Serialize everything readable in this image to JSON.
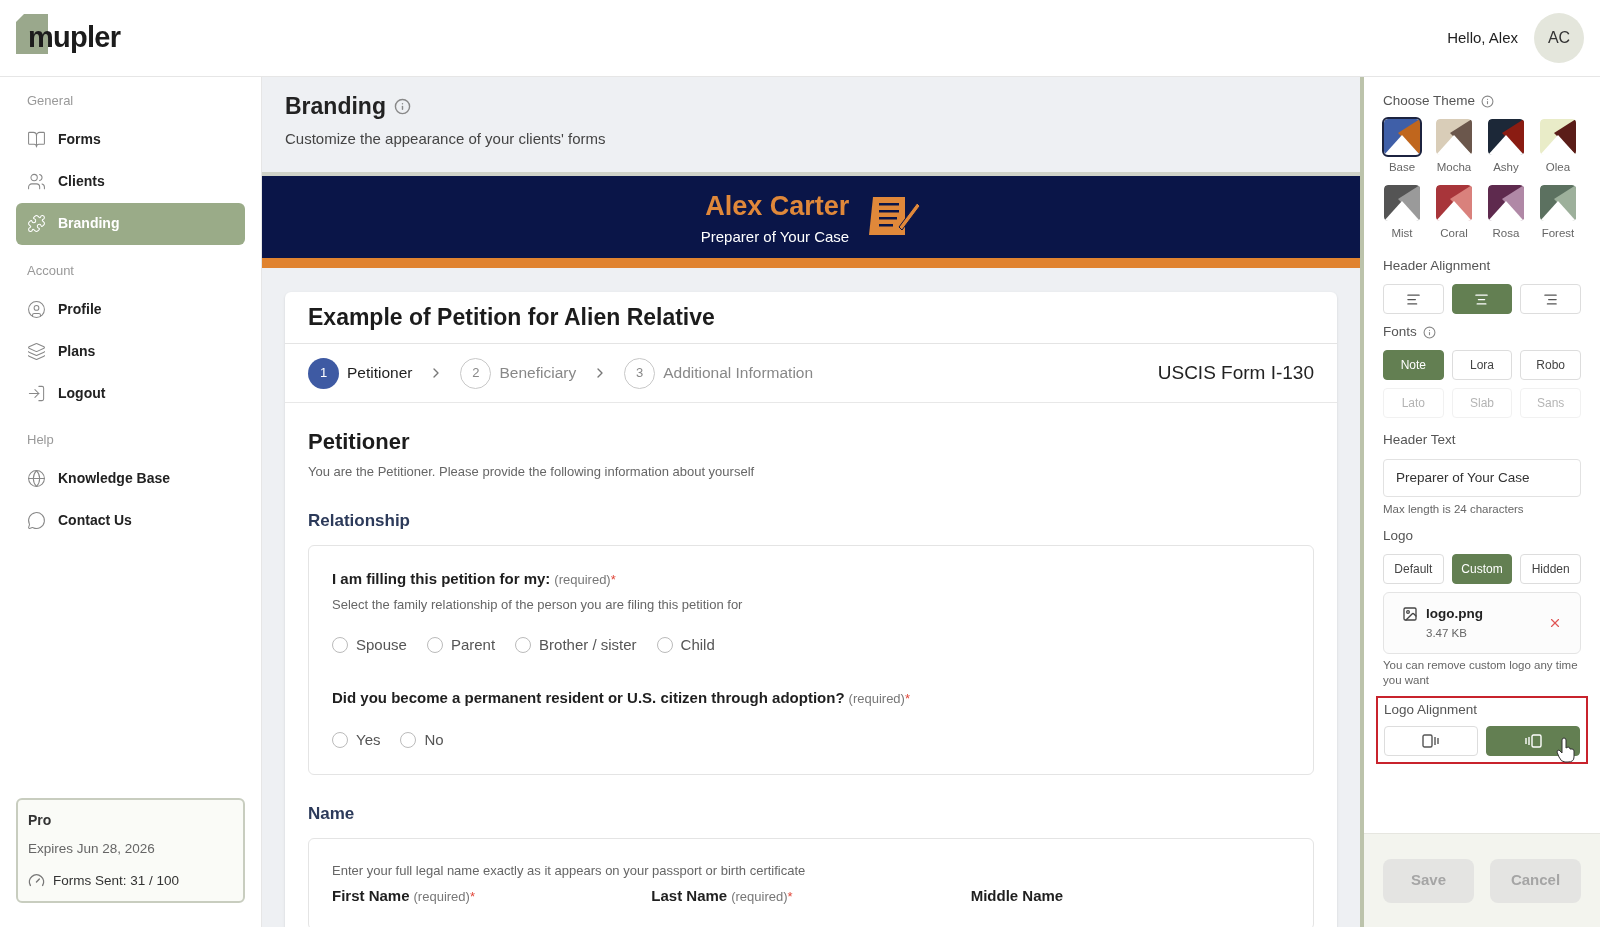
{
  "brand": {
    "name": "mupler"
  },
  "user": {
    "greeting": "Hello, Alex",
    "initials": "AC"
  },
  "sidebar": {
    "sections": [
      {
        "title": "General",
        "items": [
          {
            "label": "Forms",
            "selected": false
          },
          {
            "label": "Clients",
            "selected": false
          },
          {
            "label": "Branding",
            "selected": true
          }
        ]
      },
      {
        "title": "Account",
        "items": [
          {
            "label": "Profile",
            "selected": false
          },
          {
            "label": "Plans",
            "selected": false
          },
          {
            "label": "Logout",
            "selected": false
          }
        ]
      },
      {
        "title": "Help",
        "items": [
          {
            "label": "Knowledge Base",
            "selected": false
          },
          {
            "label": "Contact Us",
            "selected": false
          }
        ]
      }
    ],
    "plan": {
      "name": "Pro",
      "expires": "Expires Jun 28, 2026",
      "usage": "Forms Sent: 31 / 100"
    }
  },
  "page": {
    "title": "Branding",
    "subtitle": "Customize the appearance of your clients' forms"
  },
  "preview": {
    "header": {
      "name": "Alex Carter",
      "text": "Preparer of Your Case"
    },
    "form_title": "Example of Petition for Alien Relative",
    "steps": [
      {
        "number": "1",
        "label": "Petitioner",
        "selected": true
      },
      {
        "number": "2",
        "label": "Beneficiary",
        "selected": false
      },
      {
        "number": "3",
        "label": "Additional Information",
        "selected": false
      }
    ],
    "form_code": "USCIS Form I-130",
    "section_title": "Petitioner",
    "section_desc": "You are the Petitioner. Please provide the following information about yourself",
    "groups": [
      {
        "title": "Relationship",
        "questions": [
          {
            "label": "I am filling this petition for my:",
            "required": "(required)",
            "mark": "*",
            "hint": "Select the family relationship of the person you are filing this petition for",
            "options": [
              {
                "label": "Spouse",
                "selected": false
              },
              {
                "label": "Parent",
                "selected": false
              },
              {
                "label": "Brother / sister",
                "selected": false
              },
              {
                "label": "Child",
                "selected": false
              }
            ]
          },
          {
            "label": "Did you become a permanent resident or U.S. citizen through adoption?",
            "required": "(required)",
            "mark": "*",
            "options": [
              {
                "label": "Yes",
                "selected": false
              },
              {
                "label": "No",
                "selected": false
              }
            ]
          }
        ]
      },
      {
        "title": "Name",
        "hint": "Enter your full legal name exactly as it appears on your passport or birth certificate",
        "fields": [
          {
            "label": "First Name",
            "required": "(required)",
            "mark": "*"
          },
          {
            "label": "Last Name",
            "required": "(required)",
            "mark": "*"
          },
          {
            "label": "Middle Name"
          }
        ]
      }
    ]
  },
  "settings": {
    "theme": {
      "title": "Choose Theme",
      "themes": [
        {
          "name": "Base",
          "color": "#3f5fa8",
          "selected": true
        },
        {
          "name": "Mocha",
          "color": "#d9cdb8",
          "selected": false
        },
        {
          "name": "Ashy",
          "color": "#1c2838",
          "selected": false
        },
        {
          "name": "Olea",
          "color": "#e9ecc8",
          "selected": false
        },
        {
          "name": "Mist",
          "color": "#545454",
          "selected": false
        },
        {
          "name": "Coral",
          "color": "#a8353a",
          "selected": false
        },
        {
          "name": "Rosa",
          "color": "#5e2a4e",
          "selected": false
        },
        {
          "name": "Forest",
          "color": "#5c7160",
          "selected": false
        }
      ]
    },
    "header_alignment": {
      "title": "Header Alignment",
      "options": [
        {
          "kind": "left",
          "selected": false
        },
        {
          "kind": "center",
          "selected": true
        },
        {
          "kind": "right",
          "selected": false
        }
      ]
    },
    "fonts": {
      "title": "Fonts",
      "options": [
        {
          "label": "Note",
          "selected": true,
          "disabled": false
        },
        {
          "label": "Lora",
          "selected": false,
          "disabled": false
        },
        {
          "label": "Robo",
          "selected": false,
          "disabled": false
        },
        {
          "label": "Lato",
          "selected": false,
          "disabled": true
        },
        {
          "label": "Slab",
          "selected": false,
          "disabled": true
        },
        {
          "label": "Sans",
          "selected": false,
          "disabled": true
        }
      ]
    },
    "header_text": {
      "title": "Header Text",
      "value": "Preparer of Your Case",
      "hint": "Max length is 24 characters"
    },
    "logo": {
      "title": "Logo",
      "options": [
        {
          "label": "Default",
          "selected": false
        },
        {
          "label": "Custom",
          "selected": true
        },
        {
          "label": "Hidden",
          "selected": false
        }
      ],
      "file": {
        "name": "logo.png",
        "size": "3.47 KB"
      },
      "note": "You can remove custom logo any time you want"
    },
    "logo_alignment": {
      "title": "Logo Alignment",
      "highlighted": true,
      "options": [
        {
          "kind": "left",
          "selected": false
        },
        {
          "kind": "center",
          "selected": true
        }
      ]
    },
    "buttons": [
      {
        "label": "Save",
        "disabled": true
      },
      {
        "label": "Cancel",
        "disabled": true
      }
    ]
  }
}
